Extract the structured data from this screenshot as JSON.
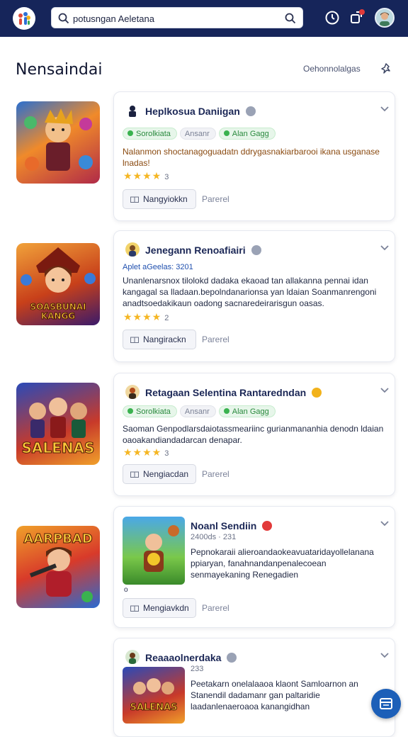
{
  "header": {
    "search": {
      "value": "potusngan Aeletana"
    },
    "icons": {
      "logo": "app-logo-icon",
      "search_left": "search-icon",
      "search_right": "search-icon",
      "clock": "clock-icon",
      "share": "share-icon",
      "avatar": "user-avatar"
    }
  },
  "page": {
    "title": "Nensaindai",
    "header_link": "Oehonnolalgas",
    "pin_icon": "pin-icon"
  },
  "cards": [
    {
      "title": "Heplkosua Daniigan",
      "pills": [
        "Sorolkiata",
        "Ansanr",
        "Alan Gagg"
      ],
      "description": "Nalanmon shoctanagoguadatn ddrygasnakiarbarooi ikana usganase lnadas!",
      "rating": "3",
      "primary": "Nangyiokkn",
      "secondary": "Parerel"
    },
    {
      "title": "Jenegann Renoafiairi",
      "subtitle": "Aplet aGeelas: 3201",
      "description": "Unanlenarsnox tilolokd dadaka ekaoad tan allakanna pennai idan kangagal sa lladaan.bepolndanarionsa yan ldaian Soanmanrengoni anadtsoedakikaun oadong sacnaredeirarisgun oasas.",
      "rating": "2",
      "primary": "Nangirackn",
      "secondary": "Parerel",
      "thumb_text": "SOASBUNAI KANGG"
    },
    {
      "title": "Retagaan Selentina Rantaredndan",
      "pills": [
        "Sorolkiata",
        "Ansanr",
        "Alan Gagg"
      ],
      "description": "Saoman Genpodlarsdaiotassmeariinc gurianmananhia denodn ldaian oaoakandiandadarcan denapar.",
      "rating": "3",
      "primary": "Nengiacdan",
      "secondary": "Parerel",
      "thumb_text": "SALENAS"
    },
    {
      "title": "Noanl Sendiin",
      "meta": "2400ds · 231",
      "description": "Pepnokaraii alieroandaokeavuataridayollelanana ppiaryan, fanahnandanpenalecoean senmayekaning Renegadien",
      "extra": "o",
      "primary": "Mengiavkdn",
      "secondary": "Parerel",
      "thumb_text": "AARPBAD"
    },
    {
      "title": "Reaaaolnerdaka",
      "meta": "233",
      "description": "Peetakarn onelalaaoa klaont Samloarnon an Stanendil dadamanr gan paltaridie laadanlenaeroaoa kanangidhan",
      "inner_text": "SALENAS"
    }
  ],
  "fab": {
    "icon": "calendar-icon"
  }
}
